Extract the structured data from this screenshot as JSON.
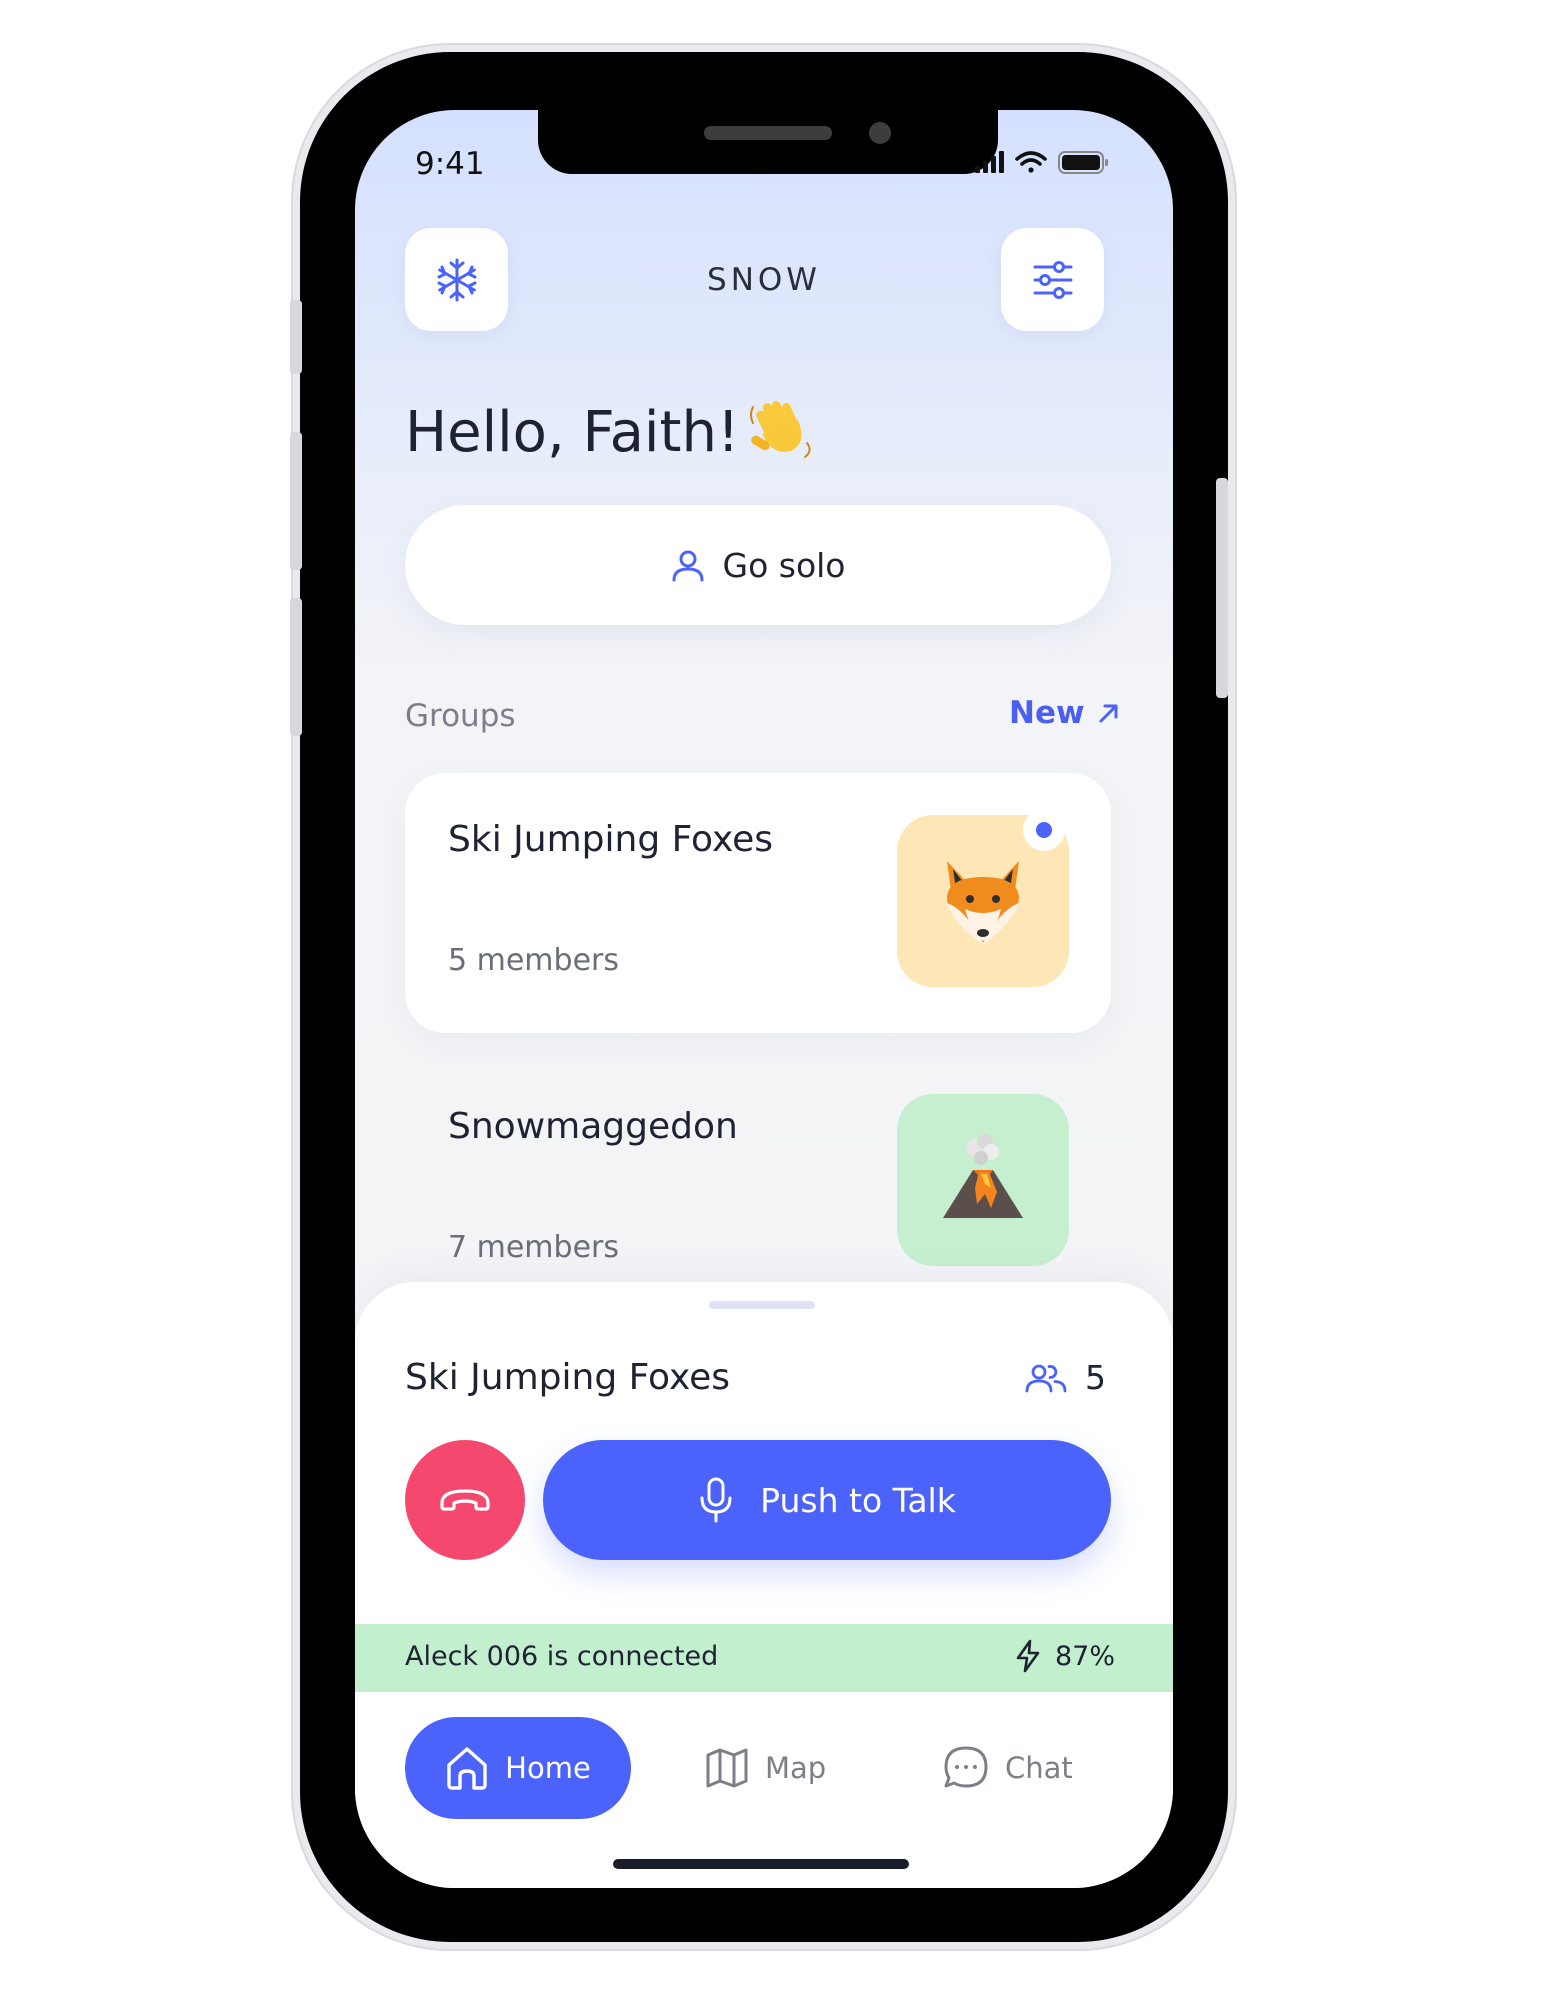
{
  "status_bar": {
    "time": "9:41"
  },
  "header": {
    "logo_icon": "snowflake-icon",
    "title": "SNOW",
    "settings_icon": "sliders-icon"
  },
  "greeting": {
    "text": "Hello, Faith!",
    "emoji": "waving-hand"
  },
  "solo_button": {
    "icon": "user-icon",
    "label": "Go solo"
  },
  "groups": {
    "label": "Groups",
    "new_label": "New",
    "items": [
      {
        "name": "Ski Jumping Foxes",
        "members": "5 members",
        "avatar": "fox",
        "avatar_bg": "#fde7b6",
        "unread": true
      },
      {
        "name": "Snowmaggedon",
        "members": "7 members",
        "avatar": "volcano",
        "avatar_bg": "#c6efd0",
        "unread": false
      }
    ]
  },
  "active_group": {
    "name": "Ski Jumping Foxes",
    "member_count": "5",
    "push_to_talk_label": "Push to Talk"
  },
  "connection": {
    "text": "Aleck 006 is connected",
    "battery": "87%"
  },
  "bottom_nav": {
    "items": [
      {
        "label": "Home",
        "icon": "home-icon",
        "active": true
      },
      {
        "label": "Map",
        "icon": "map-icon",
        "active": false
      },
      {
        "label": "Chat",
        "icon": "chat-icon",
        "active": false
      }
    ]
  },
  "colors": {
    "accent": "#4b62fb",
    "hangup": "#f5486e",
    "connected_bar": "#c2efce"
  }
}
